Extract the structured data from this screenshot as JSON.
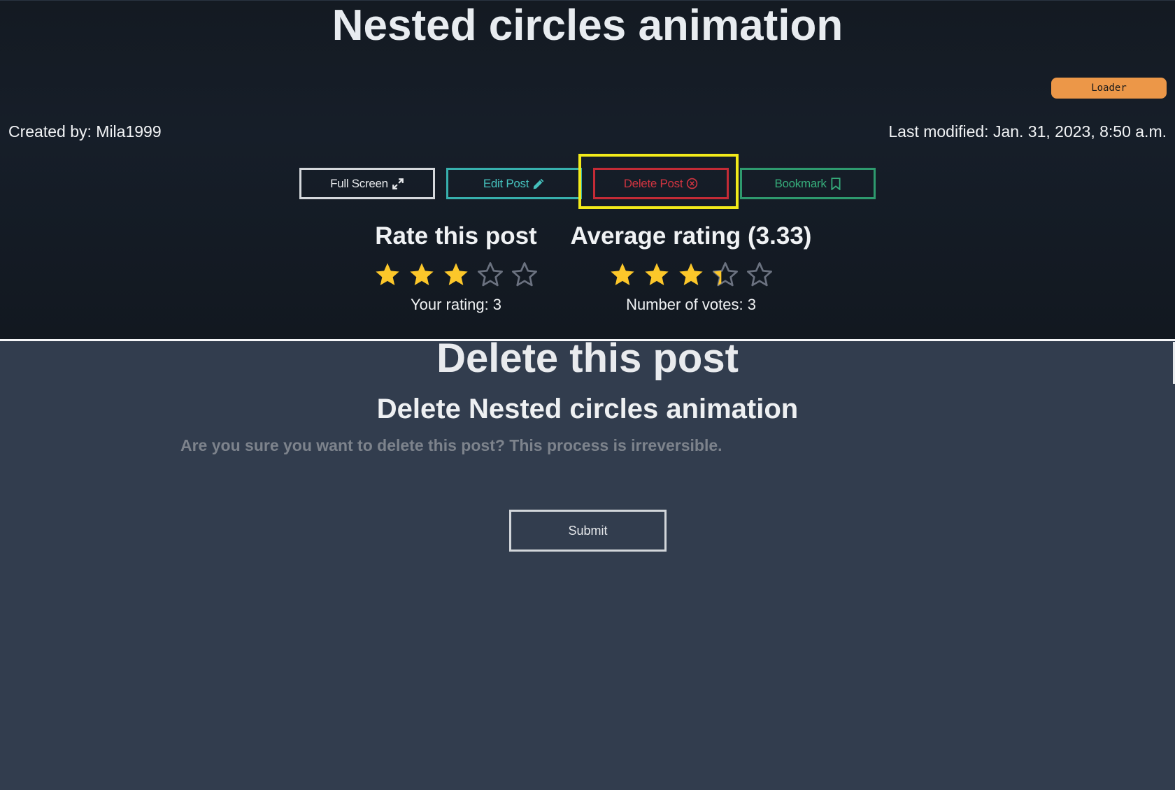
{
  "post": {
    "title": "Nested circles animation",
    "loader_label": "Loader",
    "created_by": "Created by: Mila1999",
    "last_modified": "Last modified: Jan. 31, 2023, 8:50 a.m."
  },
  "actions": {
    "full_screen": "Full Screen",
    "edit_post": "Edit Post",
    "delete_post": "Delete Post",
    "bookmark": "Bookmark"
  },
  "rating": {
    "rate_title": "Rate this post",
    "user_rating_value": 3,
    "user_rating_label": "Your rating: 3",
    "average_title": "Average rating (3.33)",
    "average_value": 3.33,
    "votes_label": "Number of votes: 3",
    "max_stars": 5
  },
  "delete_form": {
    "heading": "Delete this post",
    "subheading": "Delete Nested circles animation",
    "confirm_text": "Are you sure you want to delete this post? This process is irreversible.",
    "submit_label": "Submit"
  },
  "colors": {
    "star_filled": "#fcc72a",
    "star_empty": "#6b7280",
    "highlight": "#f2ea1a",
    "loader_bg": "#ec9748"
  }
}
